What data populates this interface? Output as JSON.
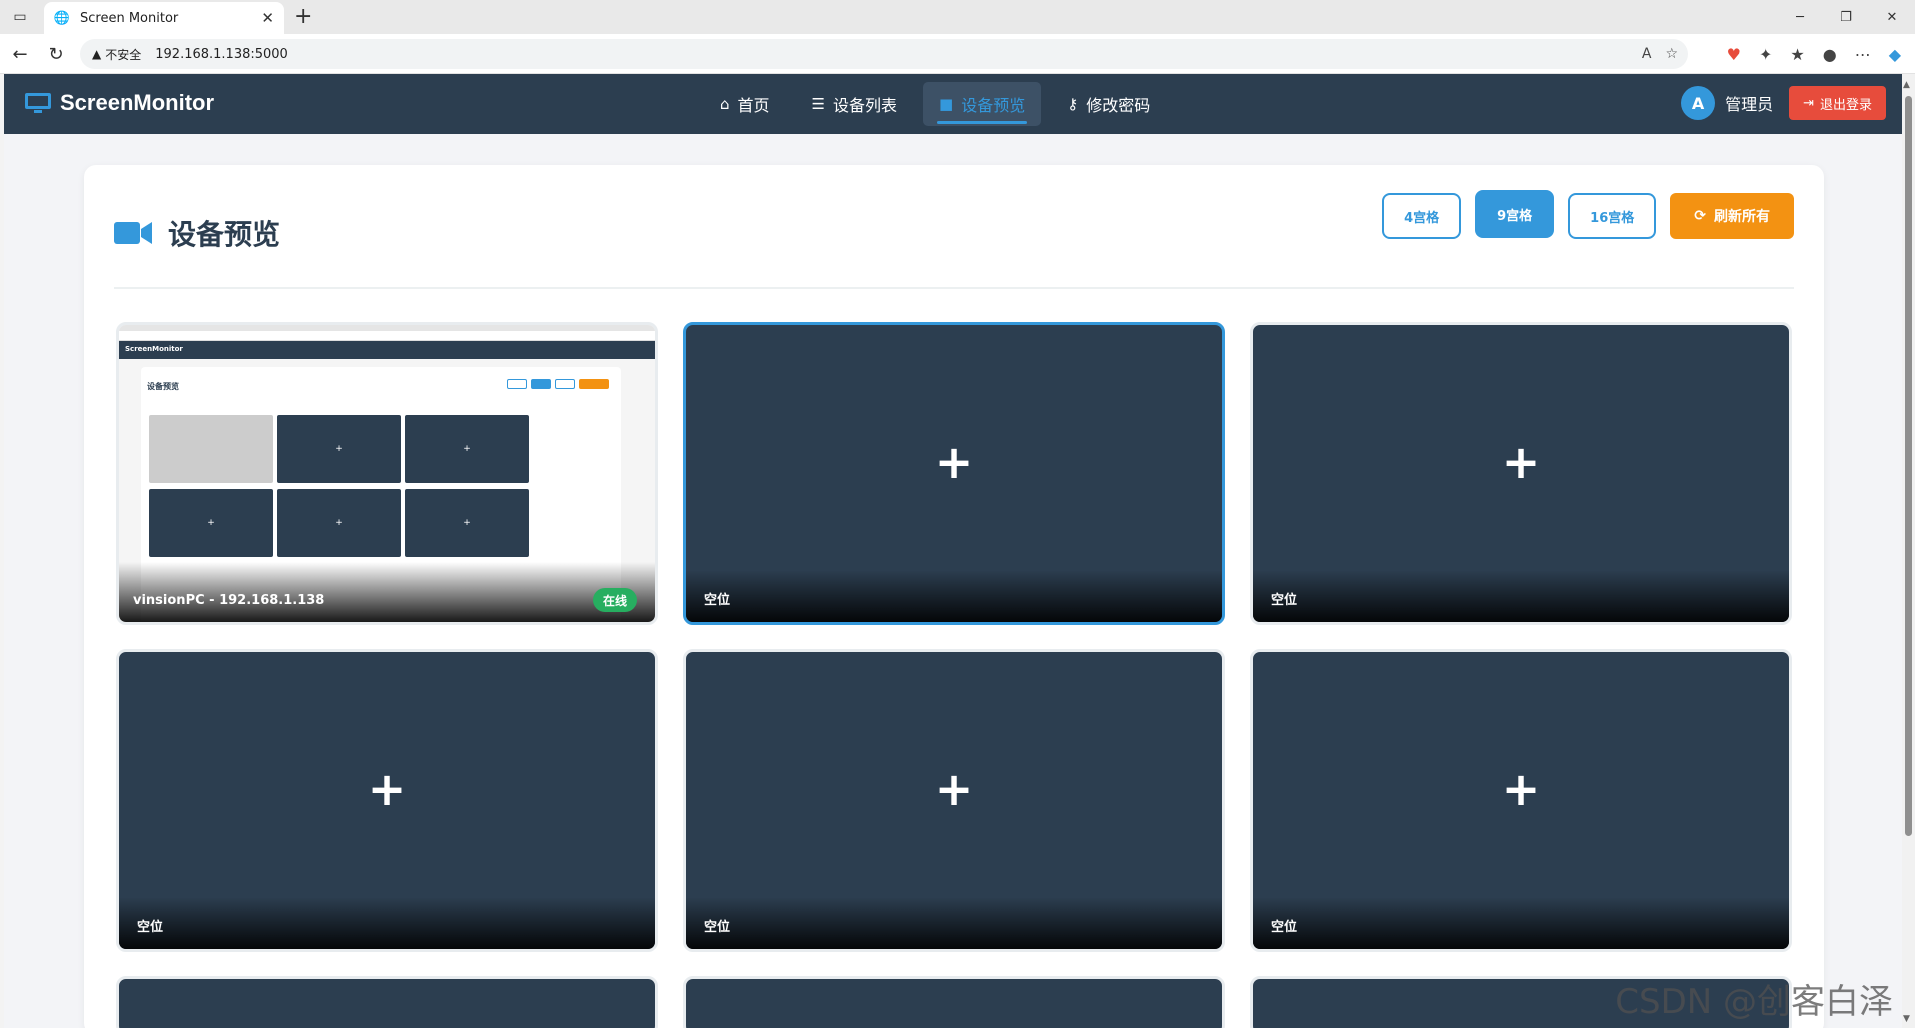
{
  "browser": {
    "tab_title": "Screen Monitor",
    "insecure_label": "不安全",
    "url": "192.168.1.138:5000"
  },
  "app": {
    "brand": "ScreenMonitor",
    "nav": [
      {
        "label": "首页",
        "icon": "home-icon"
      },
      {
        "label": "设备列表",
        "icon": "list-icon"
      },
      {
        "label": "设备预览",
        "icon": "video-icon",
        "active": true
      },
      {
        "label": "修改密码",
        "icon": "key-icon"
      }
    ],
    "user": {
      "avatar_letter": "A",
      "name": "管理员"
    },
    "logout_label": "退出登录"
  },
  "preview": {
    "title": "设备预览",
    "layouts": [
      "4宫格",
      "9宫格",
      "16宫格"
    ],
    "selected_layout": "9宫格",
    "refresh_label": "刷新所有",
    "cells": [
      {
        "type": "device",
        "label": "vinsionPC - 192.168.1.138",
        "status": "在线"
      },
      {
        "type": "empty",
        "label": "空位",
        "selected": true
      },
      {
        "type": "empty",
        "label": "空位"
      },
      {
        "type": "empty",
        "label": "空位"
      },
      {
        "type": "empty",
        "label": "空位"
      },
      {
        "type": "empty",
        "label": "空位"
      }
    ],
    "mini_preview": {
      "brand": "ScreenMonitor",
      "title": "设备预览"
    }
  },
  "colors": {
    "header": "#2c3e50",
    "accent": "#3498db",
    "logout": "#e74c3c",
    "refresh": "#f39212",
    "online": "#27ae60"
  },
  "watermark": "CSDN @创客白泽"
}
